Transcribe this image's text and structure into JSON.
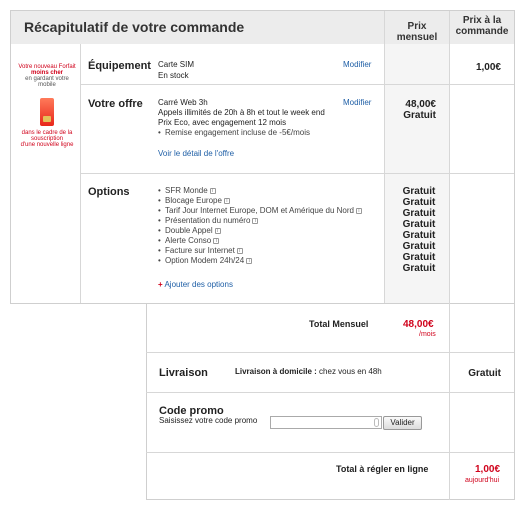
{
  "header": {
    "title": "Récapitulatif de votre commande",
    "col_monthly": "Prix mensuel",
    "col_order_l1": "Prix à la",
    "col_order_l2": "commande"
  },
  "promo_banner": {
    "line1": "Votre nouveau Forfait",
    "line2": "moins cher",
    "line3": "en gardant votre mobile",
    "line4": "dans le cadre de la souscription",
    "line5": "d'une nouvelle ligne"
  },
  "equipment": {
    "label": "Équipement",
    "name": "Carte SIM",
    "stock": "En stock",
    "modify": "Modifier",
    "price": "1,00€"
  },
  "offer": {
    "label": "Votre offre",
    "name": "Carré Web 3h",
    "line1": "Appels illimités de 20h à 8h et tout le week end",
    "line2": "Prix Eco, avec engagement 12 mois",
    "bullet": "Remise engagement incluse de -5€/mois",
    "detail_link": "Voir le détail de l'offre",
    "modify": "Modifier",
    "price": "48,00€",
    "price_note": "Gratuit"
  },
  "options": {
    "label": "Options",
    "items": [
      "SFR Monde",
      "Blocage Europe",
      "Tarif Jour Internet Europe, DOM et Amérique du Nord",
      "Présentation du numéro",
      "Double Appel",
      "Alerte Conso",
      "Facture sur Internet",
      "Option Modem 24h/24"
    ],
    "prices": [
      "Gratuit",
      "Gratuit",
      "Gratuit",
      "Gratuit",
      "Gratuit",
      "Gratuit",
      "Gratuit",
      "Gratuit"
    ],
    "add_link": "Ajouter des options"
  },
  "total_monthly": {
    "label": "Total Mensuel",
    "value": "48,00€",
    "unit": "/mois"
  },
  "delivery": {
    "label": "Livraison",
    "method": "Livraison à domicile :",
    "detail": "chez vous en 48h",
    "price": "Gratuit"
  },
  "promo": {
    "label": "Code promo",
    "prompt": "Saisissez votre code promo",
    "button": "Valider"
  },
  "total_online": {
    "label": "Total à régler en ligne",
    "value": "1,00€",
    "note": "aujourd'hui"
  },
  "colors": {
    "accent_red": "#d0021b",
    "link_blue": "#1f5fa6",
    "header_bg": "#ececec"
  }
}
